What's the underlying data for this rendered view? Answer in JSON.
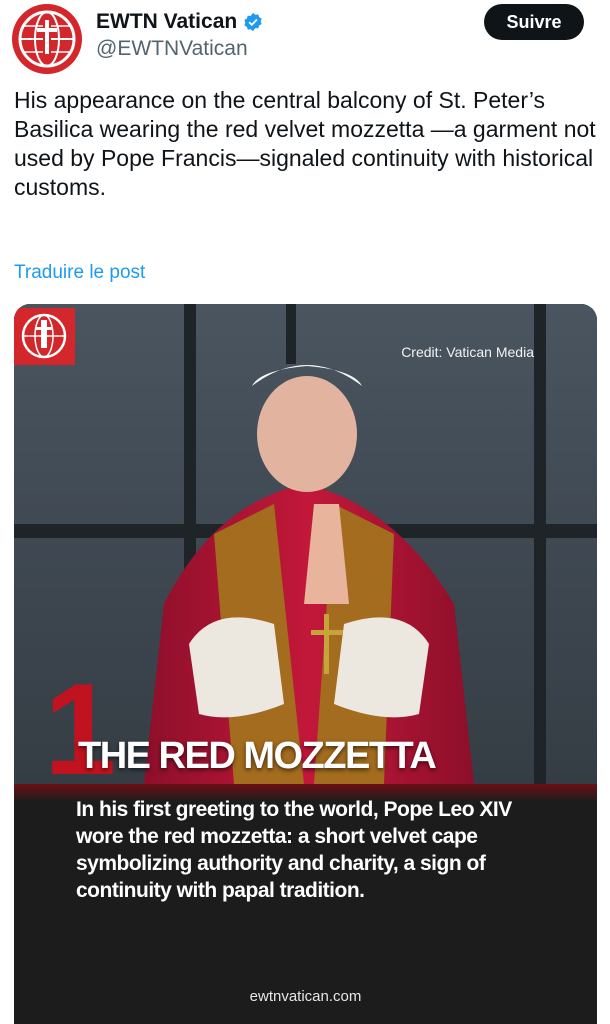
{
  "account": {
    "display_name": "EWTN Vatican",
    "handle": "@EWTNVatican",
    "verified": true,
    "avatar_icon": "ewtn-globe-cross-logo",
    "brand_color": "#d3272b"
  },
  "actions": {
    "follow_label": "Suivre"
  },
  "tweet": {
    "text": "His appearance on the central balcony of St. Peter’s Basilica wearing the red velvet mozzetta —a garment not used by Pope Francis—signaled continuity with historical customs.",
    "translate_label": "Traduire le post"
  },
  "media": {
    "credit": "Credit: Vatican Media",
    "number": "1",
    "headline": "THE RED MOZZETTA",
    "caption": "In his first greeting to the world, Pope Leo XIV wore the red mozzetta: a short velvet cape symbolizing authority and charity, a sign of continuity with papal tradition.",
    "site": "ewtnvatican.com",
    "accent_color": "#c1121f"
  }
}
